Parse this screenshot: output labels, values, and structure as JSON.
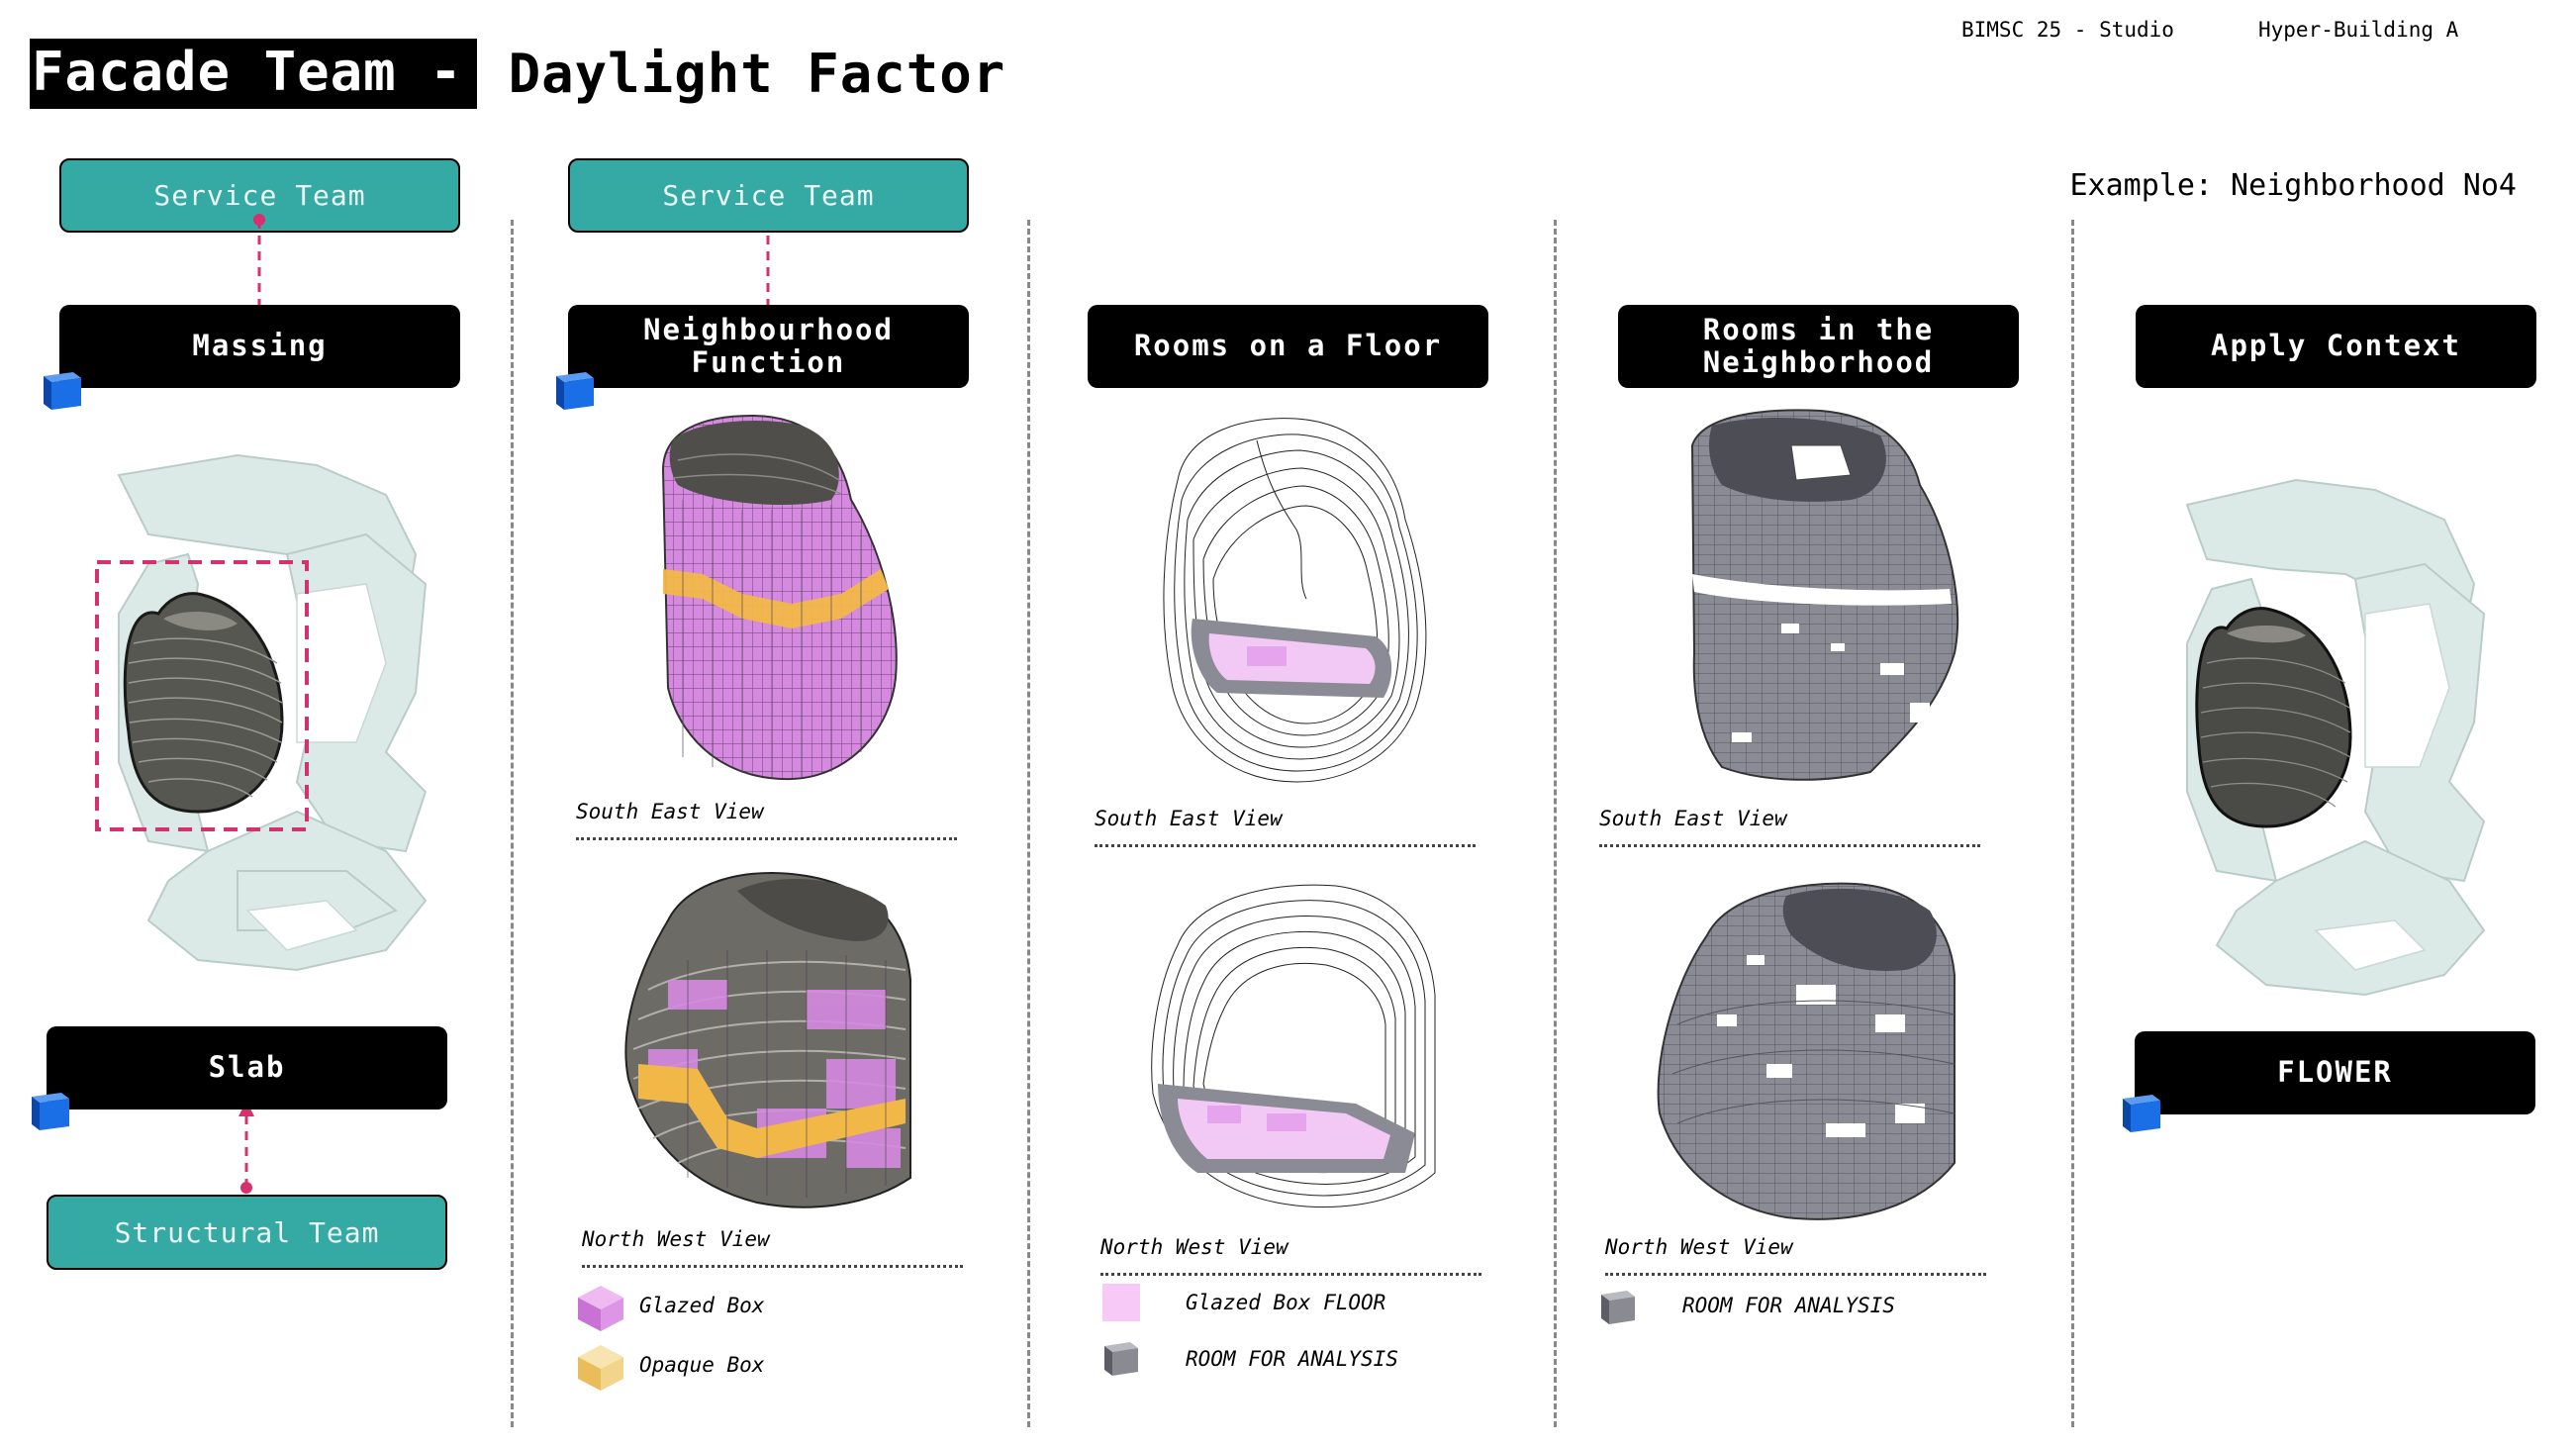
{
  "header": {
    "title_dark": "Facade Team -",
    "title_light": "Daylight Factor",
    "course": "BIMSC 25 - Studio",
    "project": "Hyper-Building A",
    "example": "Example: Neighborhood No4"
  },
  "columns": {
    "massing": {
      "service": "Service Team",
      "title": "Massing",
      "slab": "Slab",
      "structural": "Structural Team"
    },
    "function": {
      "service": "Service Team",
      "title": "Neighbourhood\nFunction",
      "view1": "South East View",
      "view2": "North West View",
      "legend": [
        {
          "label": "Glazed Box",
          "color": "#e19be9"
        },
        {
          "label": "Opaque Box",
          "color": "#f2d58a"
        }
      ]
    },
    "rooms_floor": {
      "title": "Rooms on a Floor",
      "view1": "South East View",
      "view2": "North West View",
      "legend": [
        {
          "label": "Glazed Box FLOOR",
          "color": "#f6c9f6"
        },
        {
          "label": "ROOM FOR ANALYSIS",
          "color": "#8a8a93"
        }
      ]
    },
    "rooms_neigh": {
      "title": "Rooms in the\nNeighborhood",
      "view1": "South East View",
      "view2": "North West View",
      "legend": [
        {
          "label": "ROOM FOR ANALYSIS",
          "color": "#8a8a93"
        }
      ]
    },
    "context": {
      "title": "Apply Context",
      "flower": "FLOWER"
    }
  },
  "colors": {
    "teal": "#35a9a4",
    "accent_dash": "#d6306f",
    "cube_blue": "#1565d8",
    "purple": "#d58ae0",
    "orange": "#f2b847",
    "grey_room": "#8b8b95",
    "context_mint": "#dcebe8"
  }
}
